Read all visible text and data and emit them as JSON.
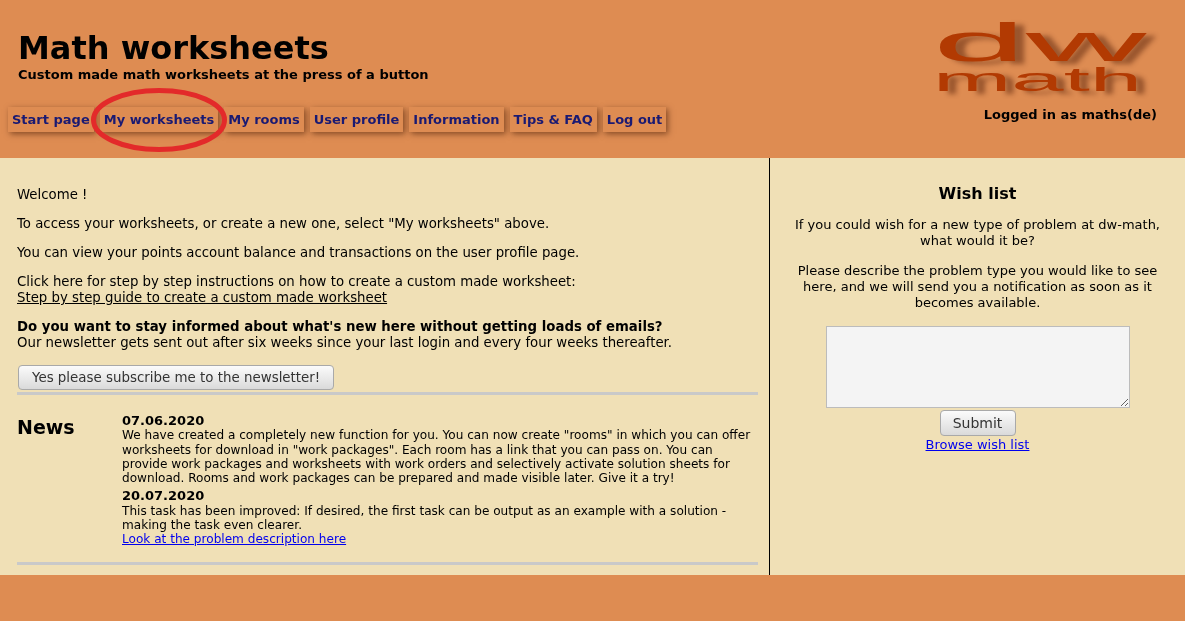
{
  "header": {
    "title": "Math worksheets",
    "subtitle": "Custom made math worksheets at the press of a button",
    "logo": {
      "line_1": "dw",
      "line_2": "math"
    },
    "login_status": "Logged in as maths(de)"
  },
  "nav": [
    {
      "label": "Start page",
      "circled": false
    },
    {
      "label": "My worksheets",
      "circled": true
    },
    {
      "label": "My rooms",
      "circled": false
    },
    {
      "label": "User profile",
      "circled": false
    },
    {
      "label": "Information",
      "circled": false
    },
    {
      "label": "Tips & FAQ",
      "circled": false
    },
    {
      "label": "Log out",
      "circled": false
    }
  ],
  "intro": {
    "paragraphs": [
      {
        "text": "Welcome !"
      },
      {
        "text": "To access your worksheets, or create a new one, select \"My worksheets\" above."
      },
      {
        "text": "You can view your points account balance and transactions on the user profile page."
      },
      {
        "text": "Click here for step by step instructions on how to create a custom made worksheet:",
        "link": "Step by step guide to create a custom made worksheet"
      }
    ],
    "newsletter": {
      "heading": "Do you want to stay informed about what's new here without getting loads of emails?",
      "text": "Our newsletter gets sent out after six weeks since your last login and every four weeks thereafter.",
      "button": "Yes please subscribe me to the newsletter!"
    }
  },
  "news": {
    "heading": "News",
    "items": [
      {
        "date": "07.06.2020",
        "text": "We have created a completely new function for you. You can now create \"rooms\" in which you can offer worksheets for download in \"work packages\". Each room has a link that you can pass on. You can provide work packages and worksheets with work orders and selectively activate solution sheets for download. Rooms and work packages can be prepared and made visible later. Give it a try!"
      },
      {
        "date": "20.07.2020",
        "text": "This task has been improved: If desired, the first task can be output as an example with a solution - making the task even clearer.",
        "link": "Look at the problem description here"
      }
    ]
  },
  "wish_list": {
    "title": "Wish list",
    "paragraphs": [
      "If you could wish for a new type of problem at dw-math, what would it be?",
      "Please describe the problem type you would like to see here, and we will send you a notification as soon as it becomes available."
    ],
    "button": "Submit",
    "link": "Browse wish list"
  }
}
